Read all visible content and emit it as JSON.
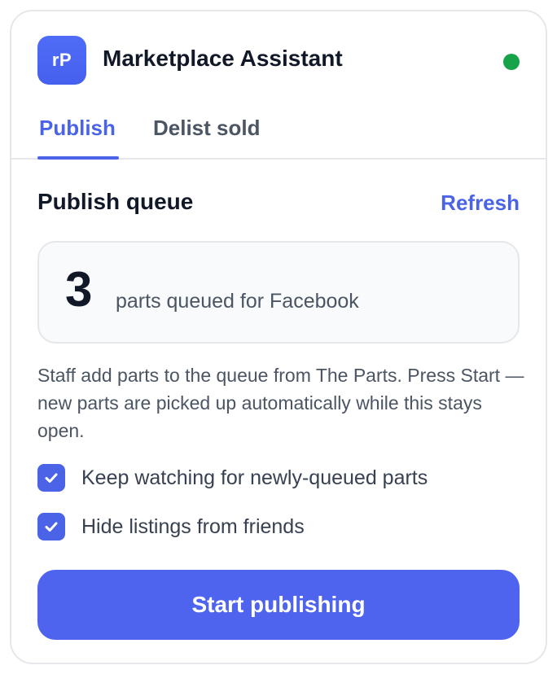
{
  "app": {
    "logo_text": "rP",
    "title": "Marketplace Assistant",
    "status_color": "#16a34a"
  },
  "tabs": [
    {
      "label": "Publish",
      "active": true
    },
    {
      "label": "Delist sold",
      "active": false
    }
  ],
  "queue": {
    "section_title": "Publish queue",
    "refresh_label": "Refresh",
    "count": "3",
    "count_text": "parts queued for Facebook"
  },
  "description": "Staff add parts to the queue from The Parts. Press Start — new parts are picked up automatically while this stays open.",
  "options": [
    {
      "label": "Keep watching for newly-queued parts",
      "checked": true
    },
    {
      "label": "Hide listings from friends",
      "checked": true
    }
  ],
  "actions": {
    "start_label": "Start publishing"
  },
  "colors": {
    "accent": "#4a63e7",
    "status_online": "#16a34a"
  },
  "icons": {
    "status": "status-dot-icon",
    "checkbox": "check-icon"
  }
}
